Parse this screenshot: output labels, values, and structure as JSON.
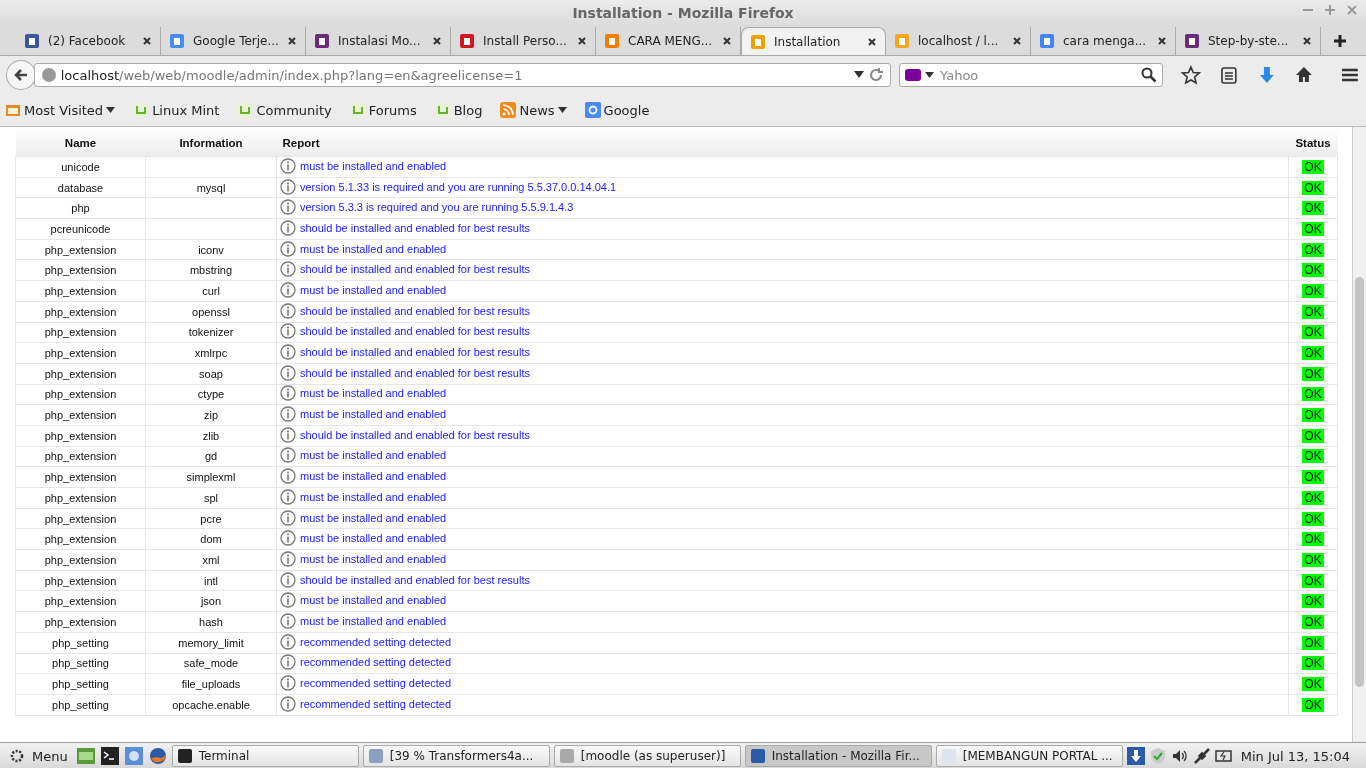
{
  "window": {
    "title": "Installation - Mozilla Firefox"
  },
  "tabs": [
    {
      "label": "(2) Facebook",
      "selected": false
    },
    {
      "label": "Google Terje...",
      "selected": false
    },
    {
      "label": "Instalasi Mo...",
      "selected": false
    },
    {
      "label": "Install Perso...",
      "selected": false
    },
    {
      "label": "CARA MENG...",
      "selected": false
    },
    {
      "label": "Installation",
      "selected": true
    },
    {
      "label": "localhost / l...",
      "selected": false
    },
    {
      "label": "cara menga...",
      "selected": false
    },
    {
      "label": "Step-by-ste...",
      "selected": false
    }
  ],
  "url": {
    "host": "localhost",
    "path": "/web/web/moodle/admin/index.php?lang=en&agreelicense=1"
  },
  "search": {
    "placeholder": "Yahoo"
  },
  "bookmarks": [
    {
      "label": "Most Visited",
      "kind": "folder"
    },
    {
      "label": "Linux Mint",
      "kind": "mint"
    },
    {
      "label": "Community",
      "kind": "mint"
    },
    {
      "label": "Forums",
      "kind": "mint"
    },
    {
      "label": "Blog",
      "kind": "mint"
    },
    {
      "label": "News",
      "kind": "feed"
    },
    {
      "label": "Google",
      "kind": "google"
    }
  ],
  "table": {
    "columns": [
      "Name",
      "Information",
      "Report",
      "Status"
    ],
    "rows": [
      {
        "name": "unicode",
        "info": "",
        "report": "must be installed and enabled",
        "status": "OK"
      },
      {
        "name": "database",
        "info": "mysql",
        "report": "version 5.1.33 is required and you are running 5.5.37.0.0.14.04.1",
        "status": "OK"
      },
      {
        "name": "php",
        "info": "",
        "report": "version 5.3.3 is required and you are running 5.5.9.1.4.3",
        "status": "OK"
      },
      {
        "name": "pcreunicode",
        "info": "",
        "report": "should be installed and enabled for best results",
        "status": "OK"
      },
      {
        "name": "php_extension",
        "info": "iconv",
        "report": "must be installed and enabled",
        "status": "OK"
      },
      {
        "name": "php_extension",
        "info": "mbstring",
        "report": "should be installed and enabled for best results",
        "status": "OK"
      },
      {
        "name": "php_extension",
        "info": "curl",
        "report": "must be installed and enabled",
        "status": "OK"
      },
      {
        "name": "php_extension",
        "info": "openssl",
        "report": "should be installed and enabled for best results",
        "status": "OK"
      },
      {
        "name": "php_extension",
        "info": "tokenizer",
        "report": "should be installed and enabled for best results",
        "status": "OK"
      },
      {
        "name": "php_extension",
        "info": "xmlrpc",
        "report": "should be installed and enabled for best results",
        "status": "OK"
      },
      {
        "name": "php_extension",
        "info": "soap",
        "report": "should be installed and enabled for best results",
        "status": "OK"
      },
      {
        "name": "php_extension",
        "info": "ctype",
        "report": "must be installed and enabled",
        "status": "OK"
      },
      {
        "name": "php_extension",
        "info": "zip",
        "report": "must be installed and enabled",
        "status": "OK"
      },
      {
        "name": "php_extension",
        "info": "zlib",
        "report": "should be installed and enabled for best results",
        "status": "OK"
      },
      {
        "name": "php_extension",
        "info": "gd",
        "report": "must be installed and enabled",
        "status": "OK"
      },
      {
        "name": "php_extension",
        "info": "simplexml",
        "report": "must be installed and enabled",
        "status": "OK"
      },
      {
        "name": "php_extension",
        "info": "spl",
        "report": "must be installed and enabled",
        "status": "OK"
      },
      {
        "name": "php_extension",
        "info": "pcre",
        "report": "must be installed and enabled",
        "status": "OK"
      },
      {
        "name": "php_extension",
        "info": "dom",
        "report": "must be installed and enabled",
        "status": "OK"
      },
      {
        "name": "php_extension",
        "info": "xml",
        "report": "must be installed and enabled",
        "status": "OK"
      },
      {
        "name": "php_extension",
        "info": "intl",
        "report": "should be installed and enabled for best results",
        "status": "OK"
      },
      {
        "name": "php_extension",
        "info": "json",
        "report": "must be installed and enabled",
        "status": "OK"
      },
      {
        "name": "php_extension",
        "info": "hash",
        "report": "must be installed and enabled",
        "status": "OK"
      },
      {
        "name": "php_setting",
        "info": "memory_limit",
        "report": "recommended setting detected",
        "status": "OK"
      },
      {
        "name": "php_setting",
        "info": "safe_mode",
        "report": "recommended setting detected",
        "status": "OK"
      },
      {
        "name": "php_setting",
        "info": "file_uploads",
        "report": "recommended setting detected",
        "status": "OK"
      },
      {
        "name": "php_setting",
        "info": "opcache.enable",
        "report": "recommended setting detected",
        "status": "OK"
      }
    ]
  },
  "taskbar": {
    "menu": "Menu",
    "windows": [
      {
        "label": "Terminal",
        "selected": false
      },
      {
        "label": "[39 % Transformers4a...",
        "selected": false
      },
      {
        "label": "[moodle (as superuser)]",
        "selected": false
      },
      {
        "label": "Installation - Mozilla Fir...",
        "selected": true
      },
      {
        "label": "[MEMBANGUN PORTAL ...",
        "selected": false
      }
    ],
    "clock": "Min Jul 13, 15:04"
  }
}
